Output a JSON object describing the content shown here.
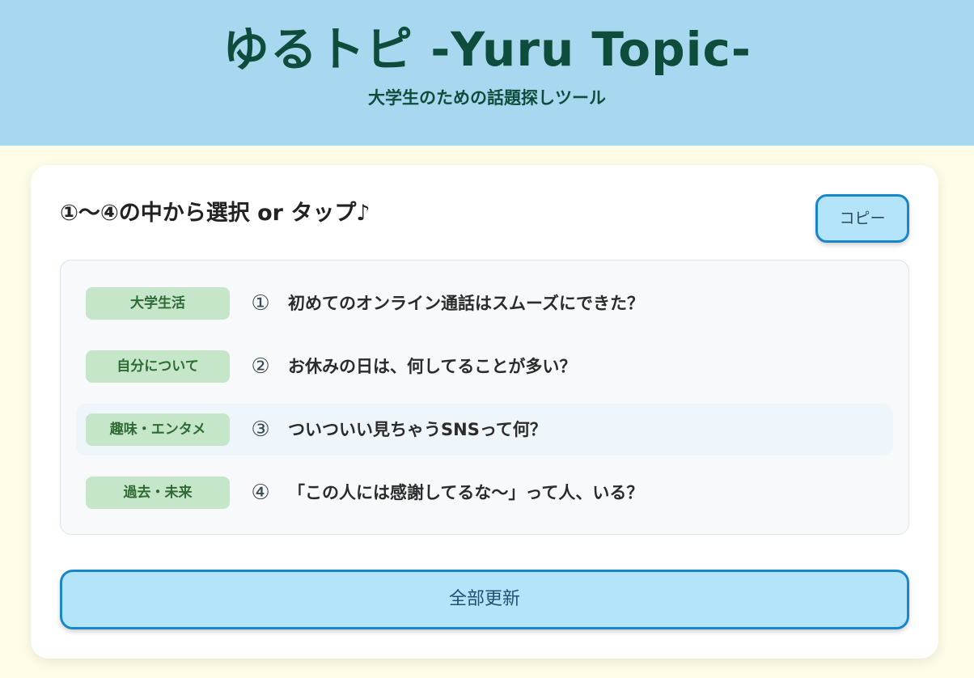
{
  "header": {
    "title": "ゆるトピ -Yuru Topic-",
    "subtitle": "大学生のための話題探しツール"
  },
  "card": {
    "instruction": "①～④の中から選択 or タップ♪",
    "copy_label": "コピー",
    "refresh_label": "全部更新"
  },
  "topics": [
    {
      "category": "大学生活",
      "number": "①",
      "text": "初めてのオンライン通話はスムーズにできた？",
      "highlighted": false
    },
    {
      "category": "自分について",
      "number": "②",
      "text": "お休みの日は、何してることが多い？",
      "highlighted": false
    },
    {
      "category": "趣味・エンタメ",
      "number": "③",
      "text": "ついついい見ちゃうSNSって何？",
      "highlighted": true
    },
    {
      "category": "過去・未来",
      "number": "④",
      "text": "「この人には感謝してるな～」って人、いる？",
      "highlighted": false
    }
  ],
  "colors": {
    "header_bg": "#a8d8ef",
    "title": "#0e4d3c",
    "page_bg": "#fefbe6",
    "button_bg": "#b3e4f9",
    "button_border": "#1886c9",
    "tag_bg": "#c6e6c9",
    "tag_text": "#2e6b34"
  }
}
